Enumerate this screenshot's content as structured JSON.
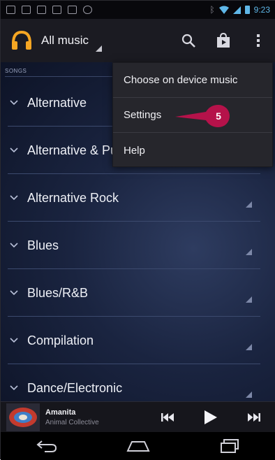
{
  "status_bar": {
    "time": "9:23",
    "notification_icons": [
      "mail-icon",
      "image-icon",
      "note-icon",
      "bag-icon",
      "bag-icon",
      "game-controller-icon"
    ],
    "status_icons": [
      "bluetooth-icon",
      "wifi-icon",
      "signal-icon",
      "battery-icon"
    ],
    "accent_color": "#5fb7e8"
  },
  "action_bar": {
    "title": "All music",
    "icons": [
      "headphones-icon",
      "search-icon",
      "shop-icon",
      "overflow-menu-icon"
    ],
    "brand_color": "#f5a623"
  },
  "section_header": "SONGS",
  "genres": [
    "Alternative",
    "Alternative & Punk",
    "Alternative Rock",
    "Blues",
    "Blues/R&B",
    "Compilation",
    "Dance/Electronic"
  ],
  "overflow_menu": {
    "items": [
      "Choose on device music",
      "Settings",
      "Help"
    ]
  },
  "callout": {
    "label": "5",
    "color": "#b5124a"
  },
  "now_playing": {
    "title": "Amanita",
    "artist": "Animal Collective",
    "controls": [
      "previous-icon",
      "play-icon",
      "next-icon"
    ]
  },
  "navigation_bar": {
    "buttons": [
      "back-icon",
      "home-icon",
      "recent-apps-icon"
    ]
  }
}
